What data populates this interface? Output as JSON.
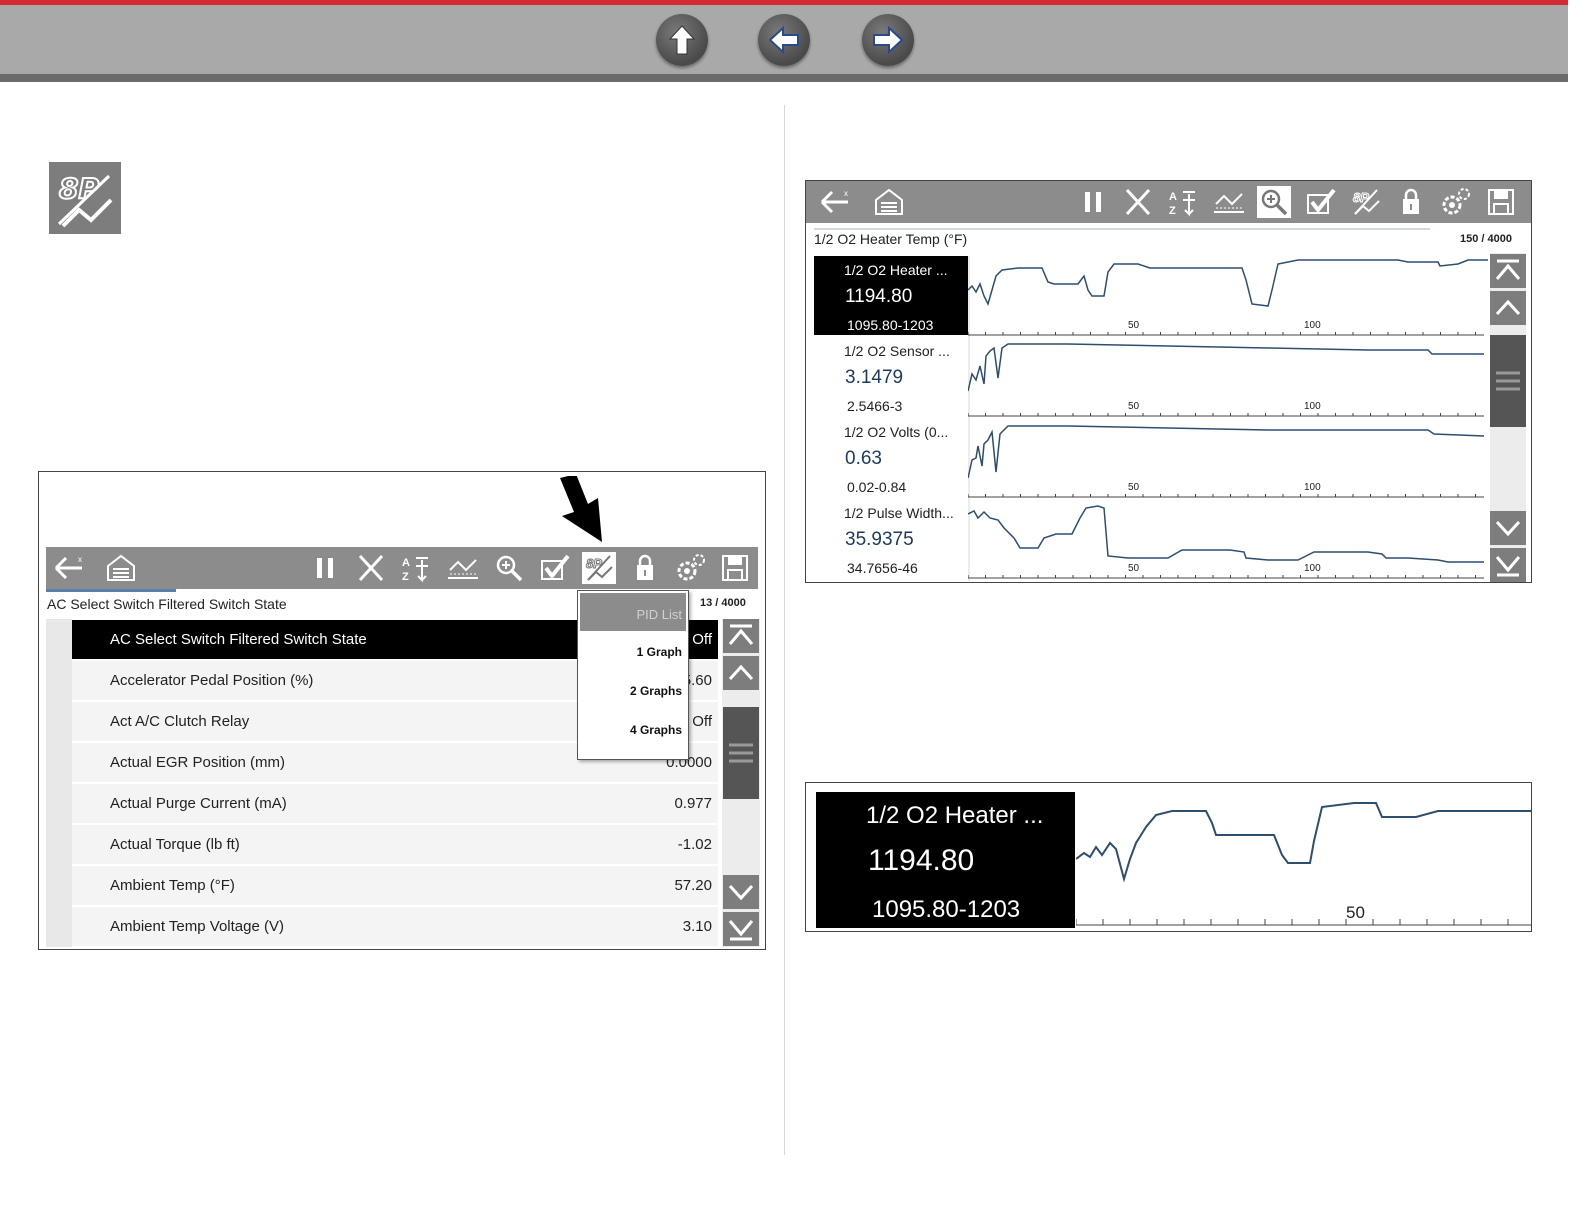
{
  "nav": {
    "up_label": "Up",
    "back_label": "Back",
    "forward_label": "Forward"
  },
  "left_screen": {
    "header_title": "AC Select Switch Filtered Switch State",
    "counter": "13 / 4000",
    "rows": [
      {
        "label": "AC Select Switch Filtered Switch State",
        "value": "Off"
      },
      {
        "label": "Accelerator Pedal Position (%)",
        "value": "5.60"
      },
      {
        "label": "Act A/C Clutch Relay",
        "value": "Off"
      },
      {
        "label": "Actual EGR Position (mm)",
        "value": "0.0000"
      },
      {
        "label": "Actual Purge Current (mA)",
        "value": "0.977"
      },
      {
        "label": "Actual Torque (lb ft)",
        "value": "-1.02"
      },
      {
        "label": "Ambient Temp (°F)",
        "value": "57.20"
      },
      {
        "label": "Ambient Temp Voltage (V)",
        "value": "3.10"
      }
    ],
    "dropdown": {
      "header": "PID List",
      "options": [
        "1 Graph",
        "2 Graphs",
        "4 Graphs"
      ]
    }
  },
  "right_screen": {
    "header_title": "1/2 O2 Heater Temp (°F)",
    "counter": "150 / 4000",
    "panels": [
      {
        "name": "1/2 O2 Heater ...",
        "value": "1194.80",
        "range": "1095.80-1203"
      },
      {
        "name": "1/2 O2 Sensor ...",
        "value": "3.1479",
        "range": "2.5466-3"
      },
      {
        "name": "1/2 O2 Volts (0...",
        "value": "0.63",
        "range": "0.02-0.84"
      },
      {
        "name": "1/2 Pulse Width...",
        "value": "35.9375",
        "range": "34.7656-46"
      }
    ],
    "tick_labels": [
      "50",
      "100"
    ]
  },
  "zoom_screen": {
    "name": "1/2 O2 Heater ...",
    "value": "1194.80",
    "range": "1095.80-1203",
    "tick_label": "50"
  },
  "colors": {
    "accent_red": "#d42a35",
    "toolbar_gray": "#8c8c8c",
    "trace_blue": "#2d4e6e"
  }
}
